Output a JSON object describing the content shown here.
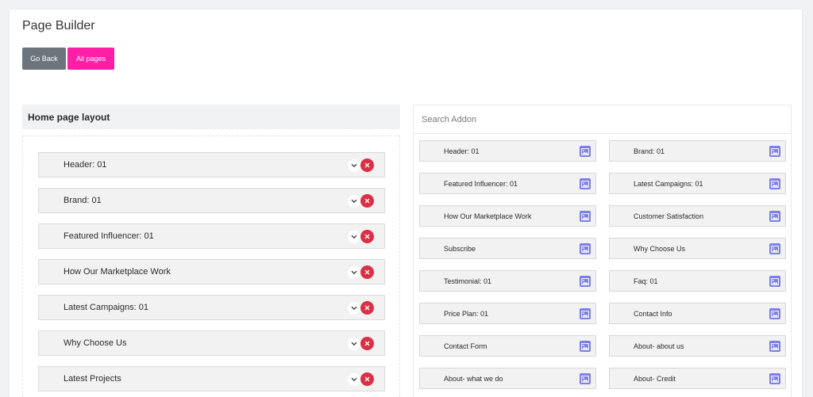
{
  "page": {
    "title": "Page Builder",
    "buttons": {
      "go_back": "Go Back",
      "all_pages": "All pages"
    }
  },
  "layout": {
    "heading": "Home page layout",
    "items": [
      "Header: 01",
      "Brand: 01",
      "Featured Influencer: 01",
      "How Our Marketplace Work",
      "Latest Campaigns: 01",
      "Why Choose Us",
      "Latest Projects"
    ]
  },
  "addons": {
    "search_placeholder": "Search Addon",
    "items": [
      "Header: 01",
      "Brand: 01",
      "Featured Influencer: 01",
      "Latest Campaigns: 01",
      "How Our Marketplace Work",
      "Customer Satisfaction",
      "Subscribe",
      "Why Choose Us",
      "Testimonial: 01",
      "Faq: 01",
      "Price Plan: 01",
      "Contact Info",
      "Contact Form",
      "About- about us",
      "About- what we do",
      "About- Credit"
    ]
  },
  "colors": {
    "go_back": "#6c757d",
    "all_pages": "#ff1fa6",
    "delete": "#dc2f45",
    "image_icon": "#7b7fe6"
  },
  "icons": {
    "expand": "chevron-down-icon",
    "delete": "close-icon",
    "addon": "image-icon"
  }
}
